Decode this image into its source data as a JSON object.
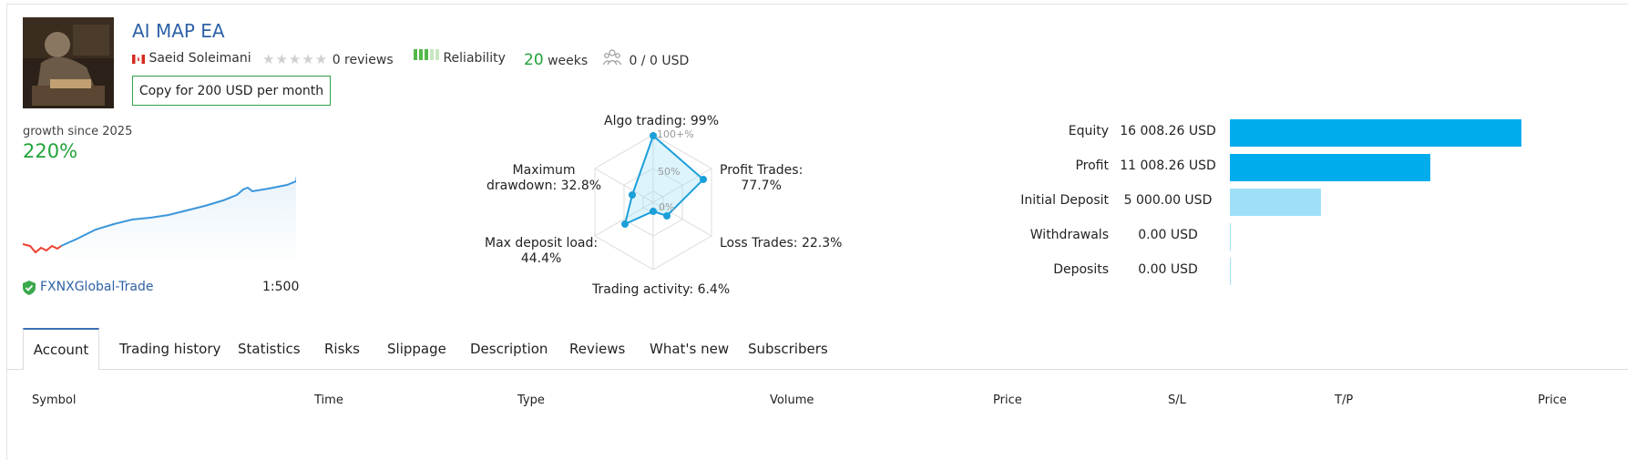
{
  "signal": {
    "title": "AI MAP EA",
    "author": "Saeid Soleimani",
    "reviews": "0 reviews",
    "reliability": "Reliability",
    "weeks_num": "20",
    "weeks_label": "weeks",
    "subscribers": "0 / 0 USD",
    "copy_button": "Copy for 200 USD per month",
    "rating_stars": 0
  },
  "growth": {
    "label": "growth since 2025",
    "value": "220%",
    "broker": "FXNXGlobal-Trade",
    "leverage": "1:500"
  },
  "radar": {
    "algo": "Algo trading: 99%",
    "profit_trades_1": "Profit Trades:",
    "profit_trades_2": "77.7%",
    "loss_trades": "Loss Trades: 22.3%",
    "trading_activity": "Trading activity: 6.4%",
    "max_deposit_1": "Max deposit load:",
    "max_deposit_2": "44.4%",
    "max_drawdown_1": "Maximum",
    "max_drawdown_2": "drawdown: 32.8%",
    "scale_100": "100+%",
    "scale_50": "50%",
    "scale_0": "0%"
  },
  "chart_data": {
    "type": "bar",
    "categories": [
      "Equity",
      "Profit",
      "Initial Deposit",
      "Withdrawals",
      "Deposits"
    ],
    "values": [
      16008.26,
      11008.26,
      5000.0,
      0.0,
      0.0
    ],
    "value_labels": [
      "16 008.26 USD",
      "11 008.26 USD",
      "5 000.00 USD",
      "0.00 USD",
      "0.00 USD"
    ],
    "colors": [
      "#00acec",
      "#00acec",
      "#9fe0f8",
      "#9fe0f8",
      "#9fe0f8"
    ],
    "xlim": [
      0,
      17500
    ]
  },
  "tabs": [
    {
      "label": "Account",
      "active": true
    },
    {
      "label": "Trading history"
    },
    {
      "label": "Statistics"
    },
    {
      "label": "Risks"
    },
    {
      "label": "Slippage"
    },
    {
      "label": "Description"
    },
    {
      "label": "Reviews"
    },
    {
      "label": "What's new"
    },
    {
      "label": "Subscribers"
    }
  ],
  "table": {
    "headers": [
      "Symbol",
      "Time",
      "Type",
      "Volume",
      "Price",
      "S/L",
      "T/P",
      "Price"
    ]
  },
  "colors": {
    "accent_blue": "#2e62a6",
    "positive_green": "#22a33a",
    "bar_blue": "#00acec",
    "bar_light": "#9fe0f8"
  }
}
